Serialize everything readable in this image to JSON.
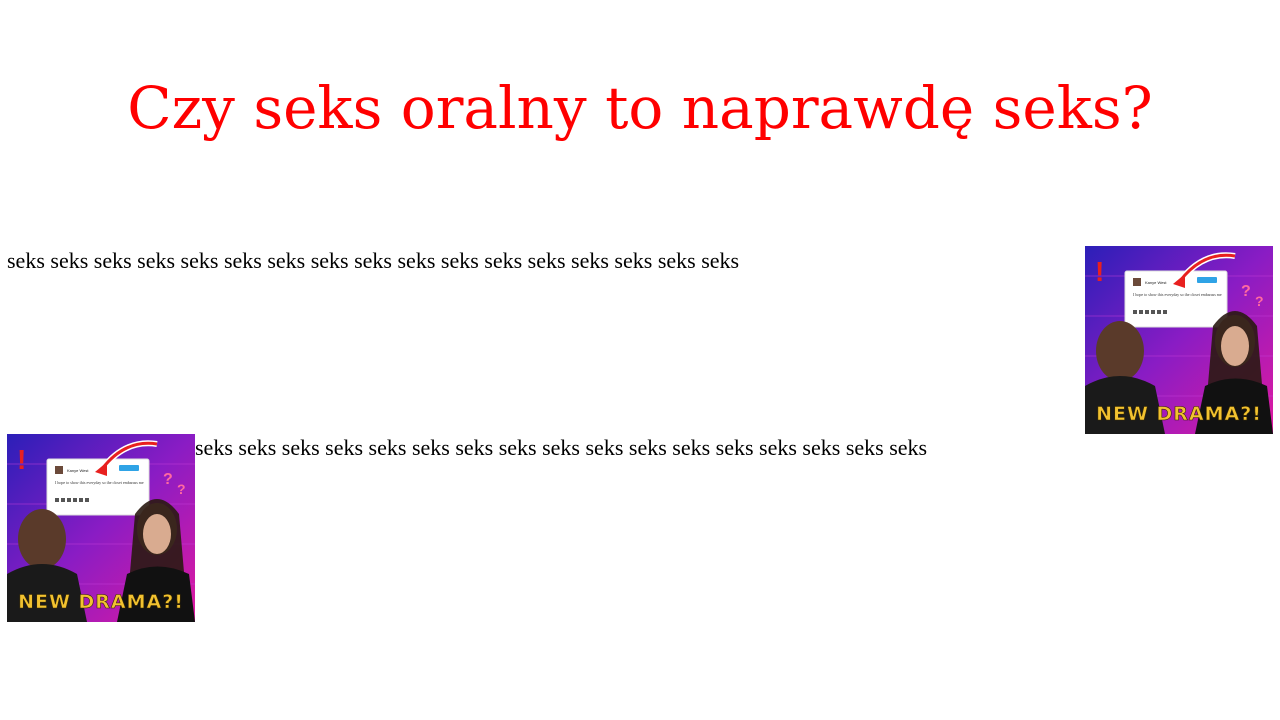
{
  "page": {
    "title": "Czy seks oralny to naprawdę seks?",
    "title_color": "#ff0000"
  },
  "paragraphs": [
    {
      "text": "seks seks seks seks seks seks seks seks seks seks seks seks seks seks seks seks seks"
    },
    {
      "text": "seks seks seks seks seks seks seks seks seks seks seks seks seks seks seks seks seks"
    }
  ],
  "thumbnail": {
    "caption": "NEW DRAMA?!",
    "tweet_name": "Kanye West",
    "tweet_text": "I hope to show this everyday so the closet embarass me",
    "follow_label": "Follow"
  }
}
